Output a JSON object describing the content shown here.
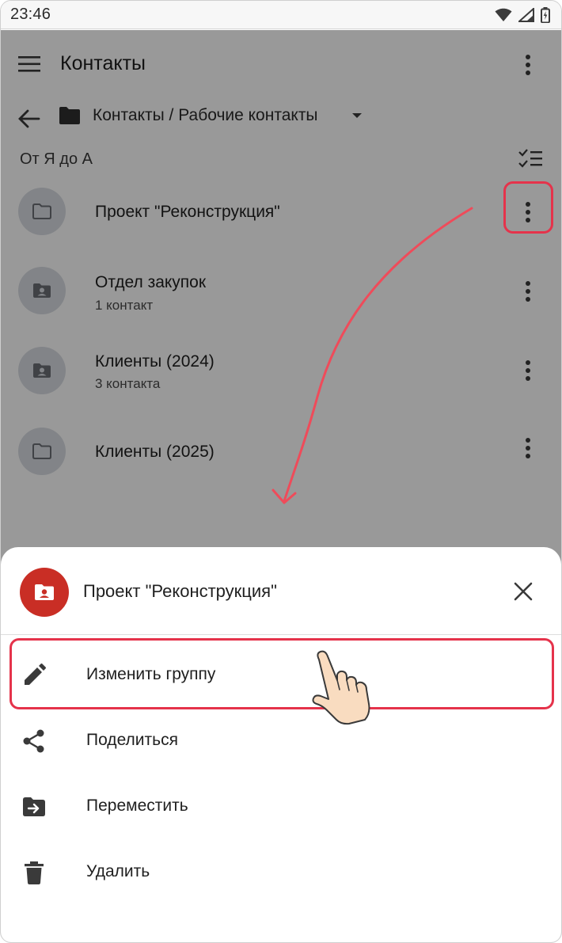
{
  "status_bar": {
    "time": "23:46"
  },
  "toolbar": {
    "title": "Контакты"
  },
  "path": {
    "text": "Контакты / Рабочие контакты"
  },
  "sort": {
    "label": "От Я до А"
  },
  "list": [
    {
      "name": "Проект \"Реконструкция\"",
      "sub": "",
      "icon": "folder-icon"
    },
    {
      "name": "Отдел закупок",
      "sub": "1 контакт",
      "icon": "contact-folder-icon"
    },
    {
      "name": "Клиенты (2024)",
      "sub": "3 контакта",
      "icon": "contact-folder-icon"
    },
    {
      "name": "Клиенты (2025)",
      "sub": "",
      "icon": "folder-icon"
    }
  ],
  "sheet": {
    "title": "Проект \"Реконструкция\"",
    "actions": [
      {
        "label": "Изменить группу",
        "icon": "pencil-icon"
      },
      {
        "label": "Поделиться",
        "icon": "share-icon"
      },
      {
        "label": "Переместить",
        "icon": "move-to-folder-icon"
      },
      {
        "label": "Удалить",
        "icon": "trash-icon"
      }
    ]
  },
  "colors": {
    "accent_red": "#e5334b",
    "sheet_avatar": "#c92e25",
    "scrim": "rgba(0,0,0,0.40)"
  }
}
